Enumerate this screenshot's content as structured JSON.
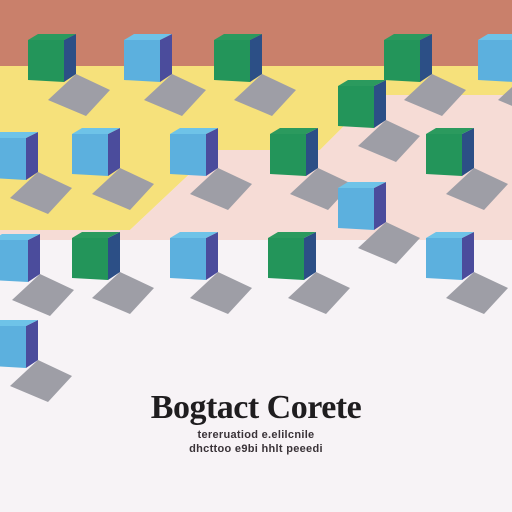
{
  "colors": {
    "top_band": "#c9806b",
    "yellow_band": "#f6e17b",
    "pink_band": "#f6dcd6",
    "floor": "#f7f3f6",
    "shadow": "#9e9ea6",
    "blue_top": "#6ec3e8",
    "blue_front": "#5cb0de",
    "blue_side": "#4b4c9c",
    "green_top": "#2b9a5e",
    "green_front": "#23955a",
    "green_side": "#2c4f86"
  },
  "title": "Bogtact Corete",
  "subtitle_line1": "tereruatiod e.elilcnile",
  "subtitle_line2": "dhcttoo e9bi hhlt peeedi",
  "cubes": [
    {
      "color": "green"
    },
    {
      "color": "blue"
    },
    {
      "color": "green"
    },
    {
      "color": "green"
    },
    {
      "color": "blue"
    },
    {
      "color": "green"
    },
    {
      "color": "blue"
    },
    {
      "color": "blue"
    },
    {
      "color": "blue"
    },
    {
      "color": "green"
    },
    {
      "color": "green"
    },
    {
      "color": "blue"
    },
    {
      "color": "blue"
    },
    {
      "color": "green"
    },
    {
      "color": "blue"
    },
    {
      "color": "green"
    },
    {
      "color": "blue"
    },
    {
      "color": "blue"
    }
  ]
}
